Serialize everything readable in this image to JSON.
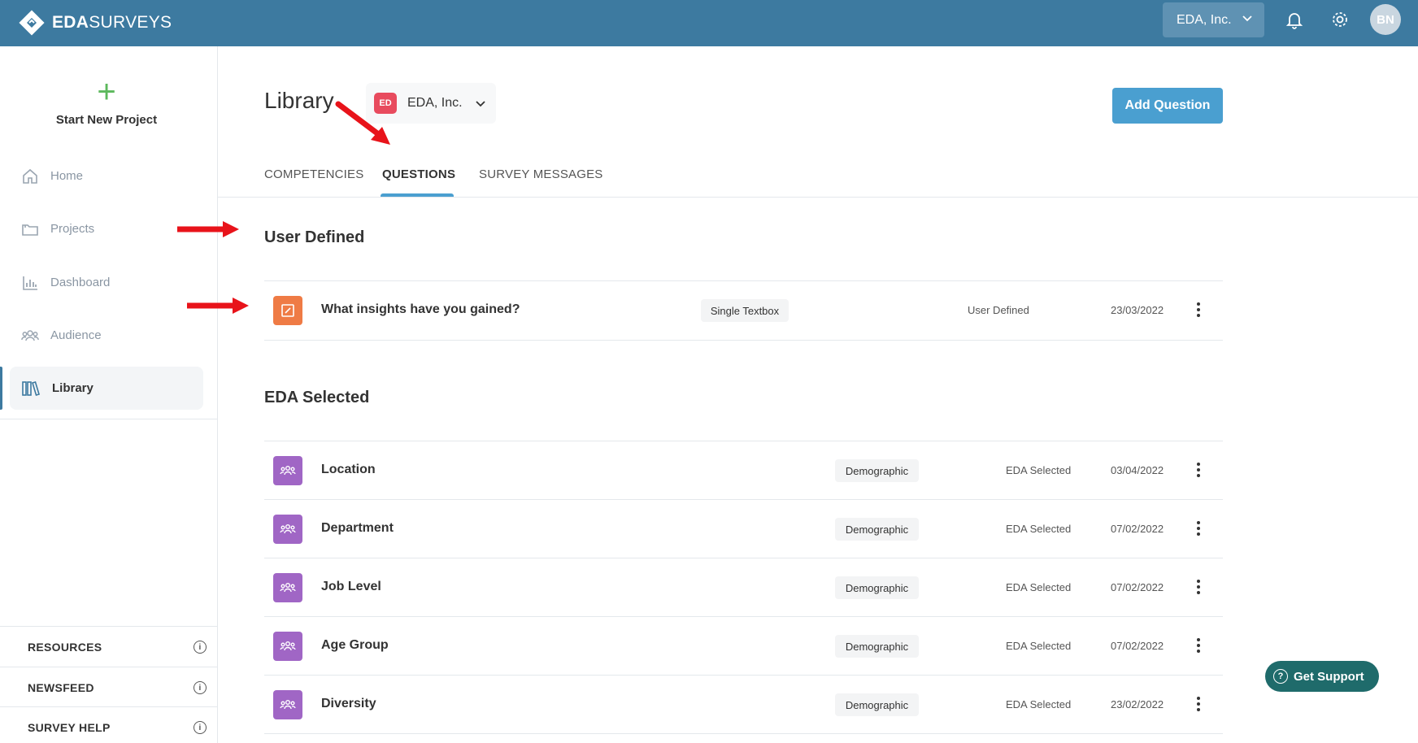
{
  "brand": {
    "name_bold": "EDA",
    "name_rest": "SURVEYS"
  },
  "topbar": {
    "org_select": "EDA, Inc.",
    "avatar_initials": "BN"
  },
  "sidebar": {
    "new_project": "Start New Project",
    "items": [
      {
        "label": "Home",
        "icon": "home-icon"
      },
      {
        "label": "Projects",
        "icon": "folder-icon"
      },
      {
        "label": "Dashboard",
        "icon": "chart-icon"
      },
      {
        "label": "Audience",
        "icon": "people-icon"
      },
      {
        "label": "Library",
        "icon": "library-icon",
        "active": true
      }
    ],
    "footer": [
      "RESOURCES",
      "NEWSFEED",
      "SURVEY HELP"
    ]
  },
  "main": {
    "title": "Library",
    "org_badge": "ED",
    "org_select": "EDA, Inc.",
    "add_button": "Add Question",
    "tabs": [
      "COMPETENCIES",
      "QUESTIONS",
      "SURVEY MESSAGES"
    ],
    "active_tab": "QUESTIONS",
    "sections": [
      {
        "title": "User Defined",
        "rows": [
          {
            "title": "What insights have you gained?",
            "type": "Single Textbox",
            "source": "User Defined",
            "date": "23/03/2022"
          }
        ]
      },
      {
        "title": "EDA Selected",
        "rows": [
          {
            "title": "Location",
            "type": "Demographic",
            "source": "EDA Selected",
            "date": "03/04/2022"
          },
          {
            "title": "Department",
            "type": "Demographic",
            "source": "EDA Selected",
            "date": "07/02/2022"
          },
          {
            "title": "Job Level",
            "type": "Demographic",
            "source": "EDA Selected",
            "date": "07/02/2022"
          },
          {
            "title": "Age Group",
            "type": "Demographic",
            "source": "EDA Selected",
            "date": "07/02/2022"
          },
          {
            "title": "Diversity",
            "type": "Demographic",
            "source": "EDA Selected",
            "date": "23/02/2022"
          }
        ]
      }
    ]
  },
  "support": {
    "label": "Get Support"
  },
  "colors": {
    "topbar": "#3d7aa0",
    "accent": "#4a9fd0",
    "orange": "#ef7b45",
    "purple": "#a066c5",
    "support": "#1f6b6b",
    "annotation": "#e8131a"
  }
}
